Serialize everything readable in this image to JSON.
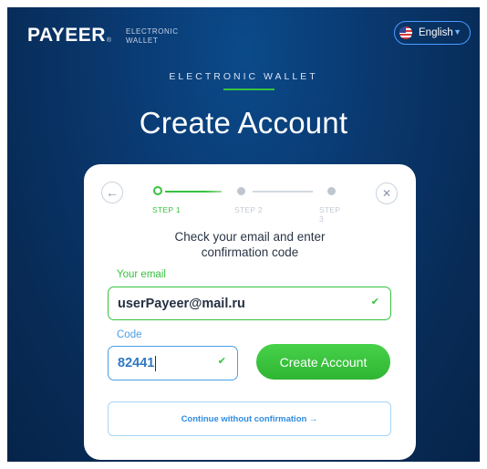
{
  "header": {
    "brand": "PAYEER",
    "brand_mark": "®",
    "brand_sub_line1": "ELECTRONIC",
    "brand_sub_line2": "WALLET",
    "language": "English",
    "language_flag_icon": "us-flag-icon",
    "language_chevron_icon": "chevron-down-icon"
  },
  "hero": {
    "kicker": "ELECTRONIC WALLET",
    "title": "Create Account"
  },
  "card": {
    "back_icon": "arrow-left-icon",
    "close_icon": "close-icon",
    "steps": [
      {
        "label": "STEP 1",
        "state": "active"
      },
      {
        "label": "STEP 2",
        "state": "pending"
      },
      {
        "label": "STEP 3",
        "state": "pending"
      }
    ],
    "instruction_line1": "Check your email and enter",
    "instruction_line2": "confirmation code",
    "email_label": "Your email",
    "email_value": "userPayeer@mail.ru",
    "code_label": "Code",
    "code_value": "82441",
    "create_button": "Create Account",
    "continue_link": "Continue without confirmation →",
    "check_icon": "checkmark-icon"
  },
  "colors": {
    "accent_green": "#37c23f",
    "accent_blue": "#4a9ee6",
    "background_navy": "#0a3a72"
  }
}
